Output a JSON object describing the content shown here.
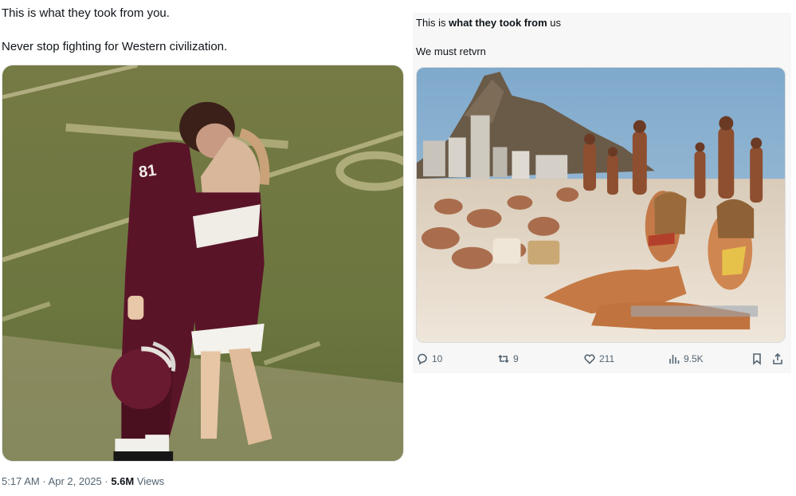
{
  "left_post": {
    "line1": "This is what they took from you.",
    "line2": "Never stop fighting for Western civilization.",
    "meta": {
      "time": "5:17 AM",
      "sep1": " · ",
      "date": "Apr 2, 2025",
      "sep2": " · ",
      "views_count": "5.6M",
      "views_label": "Views"
    },
    "jersey_number": "81"
  },
  "right_post": {
    "line1_prefix": "This is ",
    "line1_bold": "what they took from",
    "line1_suffix": " us",
    "line2": "We must retvrn",
    "actions": {
      "replies": "10",
      "reposts": "9",
      "likes": "211",
      "views": "9.5K"
    }
  },
  "colors": {
    "text": "#0f1419",
    "muted": "#536471",
    "field_green": "#6f7a3e",
    "maroon": "#5a1428",
    "sky": "#8fb6d6",
    "sand": "#e8ddd0"
  }
}
